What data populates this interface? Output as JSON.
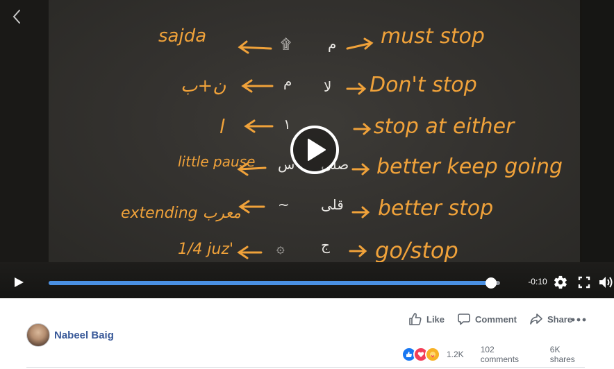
{
  "video": {
    "board_lines": [
      {
        "left": "sajda",
        "right": "must stop"
      },
      {
        "left": "ن+ب",
        "right": "Don't stop"
      },
      {
        "left": "l",
        "right": "stop at either"
      },
      {
        "left": "little pause",
        "right": "better keep going"
      },
      {
        "left": "extending معرب",
        "right": "better stop"
      },
      {
        "left": "1/4 juz'",
        "right": "go/stop"
      }
    ],
    "time_remaining": "-0:10",
    "progress_fraction": 0.98
  },
  "post": {
    "author": "Nabeel Baig",
    "actions": {
      "like": "Like",
      "comment": "Comment",
      "share": "Share"
    },
    "reaction_count": "1.2K",
    "comments": "102 comments",
    "shares": "6K shares"
  },
  "colors": {
    "chalk": "#f0a23a",
    "progress": "#4a90e2",
    "link": "#385898"
  },
  "icons": [
    "back-arrow-icon",
    "play-icon",
    "settings-icon",
    "fullscreen-icon",
    "volume-icon",
    "like-icon",
    "comment-icon",
    "share-icon",
    "more-icon"
  ]
}
